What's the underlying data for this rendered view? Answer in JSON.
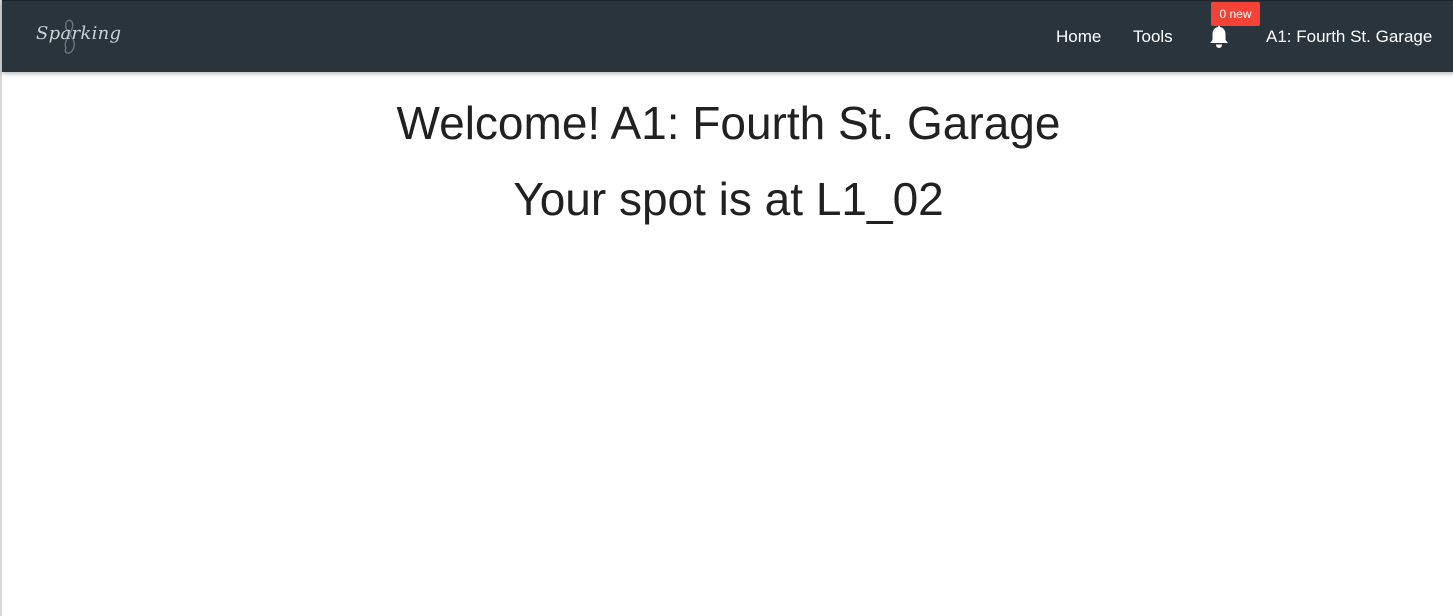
{
  "navbar": {
    "brand": "Sparking",
    "background_color": "#29343d",
    "links": {
      "home": "Home",
      "tools": "Tools",
      "user": "A1: Fourth St. Garage"
    },
    "notifications": {
      "icon": "bell-icon",
      "badge": "0 new",
      "badge_color": "#f44336"
    }
  },
  "main": {
    "welcome": "Welcome! A1: Fourth St. Garage",
    "spot": "Your spot is at L1_02"
  }
}
